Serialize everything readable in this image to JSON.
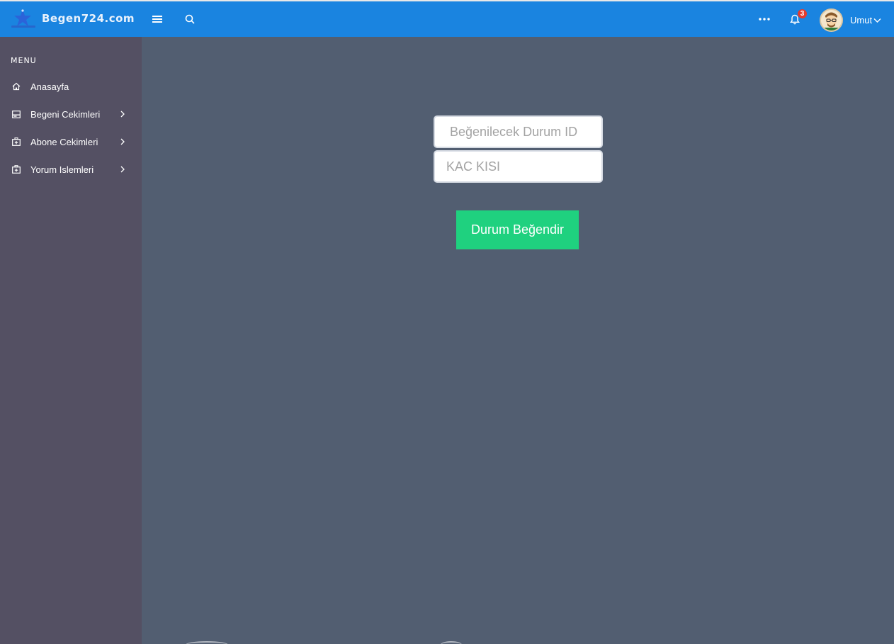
{
  "brand": {
    "name": "Begen724.com",
    "logo_icon": "star-logo-icon"
  },
  "header": {
    "menu_icon": "hamburger-icon",
    "search_icon": "search-icon",
    "more_icon": "ellipsis-icon",
    "notifications": {
      "icon": "bell-icon",
      "count": "3"
    },
    "user": {
      "name": "Umut",
      "avatar_icon": "avatar-icon",
      "caret_icon": "chevron-down-icon"
    }
  },
  "sidebar": {
    "title": "MENU",
    "items": [
      {
        "label": "Anasayfa",
        "icon": "home-icon",
        "has_submenu": false
      },
      {
        "label": "Begeni Cekimleri",
        "icon": "inbox-icon",
        "has_submenu": true
      },
      {
        "label": "Abone Cekimleri",
        "icon": "briefcase-plus-icon",
        "has_submenu": true
      },
      {
        "label": "Yorum Islemleri",
        "icon": "briefcase-plus-icon",
        "has_submenu": true
      }
    ]
  },
  "form": {
    "status_id_placeholder": "Beğenilecek Durum ID",
    "status_id_value": "",
    "count_placeholder": "KAC KISI",
    "count_value": "",
    "submit_label": "Durum Beğendir"
  },
  "colors": {
    "topbar": "#1a84e0",
    "sidebar": "#545063",
    "content": "#525e71",
    "submit": "#1fd17f",
    "badge": "#e53b2e"
  }
}
